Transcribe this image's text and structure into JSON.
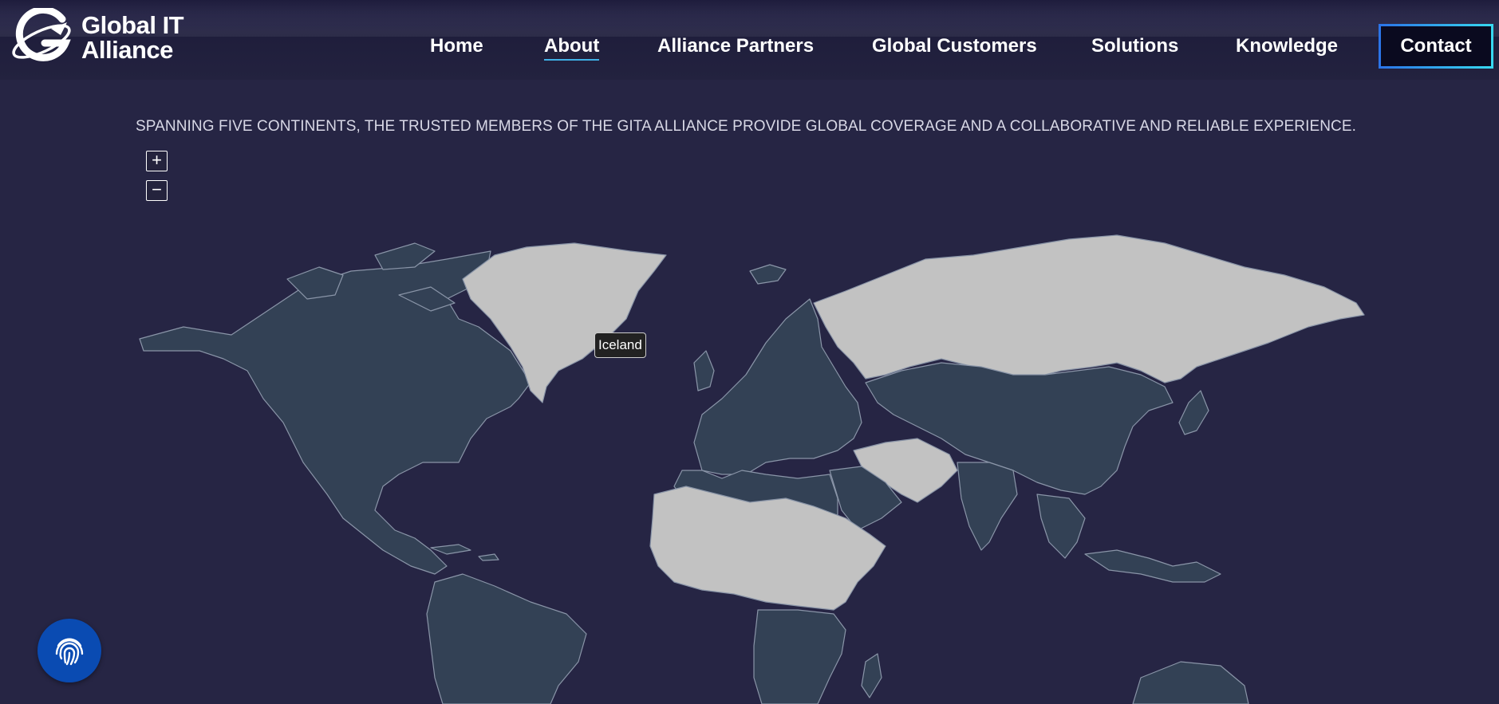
{
  "brand": {
    "logo_line1": "Global IT",
    "logo_line2": "Alliance",
    "logo_icon": "globe-g-logo-icon"
  },
  "nav": {
    "items": [
      {
        "label": "Home",
        "active": false
      },
      {
        "label": "About",
        "active": true
      },
      {
        "label": "Alliance Partners",
        "active": false
      },
      {
        "label": "Global Customers",
        "active": false
      },
      {
        "label": "Solutions",
        "active": false
      },
      {
        "label": "Knowledge",
        "active": false
      }
    ],
    "contact_label": "Contact"
  },
  "tagline": "SPANNING FIVE CONTINENTS, THE TRUSTED MEMBERS OF THE GITA ALLIANCE PROVIDE GLOBAL COVERAGE AND A COLLABORATIVE AND RELIABLE EXPERIENCE.",
  "map": {
    "zoom_in_label": "+",
    "zoom_out_label": "−",
    "tooltip": "Iceland",
    "member_color": "#334155",
    "nonmember_color": "#c2c2c2",
    "background_color": "#262544"
  },
  "fab": {
    "icon": "fingerprint-icon"
  },
  "colors": {
    "contact_border_start": "#2b74e8",
    "contact_border_end": "#37d8f0",
    "active_underline": "#3fb0e6",
    "fab_bg": "#0a4bb2"
  }
}
